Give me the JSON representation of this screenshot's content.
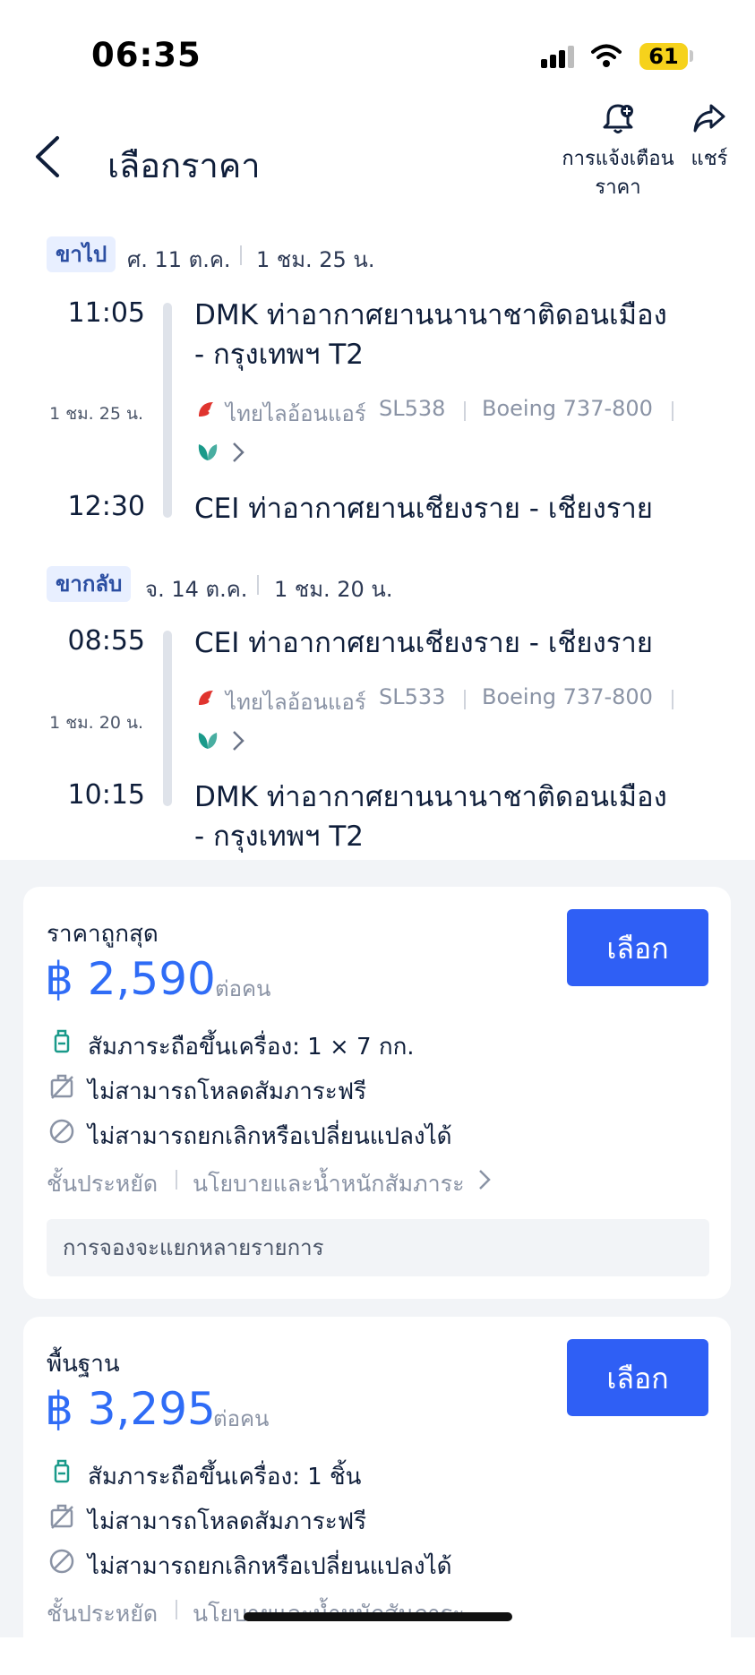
{
  "status_bar": {
    "time": "06:35",
    "battery": "61"
  },
  "header": {
    "title": "เลือกราคา",
    "alert_line1": "การแจ้งเตือน",
    "alert_line2": "ราคา",
    "share": "แชร์"
  },
  "outbound": {
    "chip": "ขาไป",
    "date": "ศ. 11 ต.ค.",
    "duration": "1 ชม. 25 น.",
    "dep_time": "11:05",
    "dep_airport_line1": "DMK  ท่าอากาศยานนานาชาติดอนเมือง",
    "dep_airport_line2": "- กรุงเทพฯ T2",
    "leg_duration": "1 ชม. 25 น.",
    "airline": "ไทยไลอ้อนแอร์",
    "flight_no": "SL538",
    "aircraft": "Boeing 737-800",
    "arr_time": "12:30",
    "arr_airport": "CEI  ท่าอากาศยานเชียงราย - เชียงราย"
  },
  "return": {
    "chip": "ขากลับ",
    "date": "จ. 14 ต.ค.",
    "duration": "1 ชม. 20 น.",
    "dep_time": "08:55",
    "dep_airport": "CEI  ท่าอากาศยานเชียงราย - เชียงราย",
    "leg_duration": "1 ชม. 20 น.",
    "airline": "ไทยไลอ้อนแอร์",
    "flight_no": "SL533",
    "aircraft": "Boeing 737-800",
    "arr_time": "10:15",
    "arr_airport_line1": "DMK  ท่าอากาศยานนานาชาติดอนเมือง",
    "arr_airport_line2": "- กรุงเทพฯ T2"
  },
  "fares": [
    {
      "title": "ราคาถูกสุด",
      "price": "฿ 2,590",
      "per": "ต่อคน",
      "button": "เลือก",
      "perk1": "สัมภาระถือขึ้นเครื่อง: 1 × 7 กก.",
      "perk2": "ไม่สามารถโหลดสัมภาระฟรี",
      "perk3": "ไม่สามารถยกเลิกหรือเปลี่ยนแปลงได้",
      "cabin": "ชั้นประหยัด",
      "policy": "นโยบายและน้ำหนักสัมภาระ",
      "notice": "การจองจะแยกหลายรายการ"
    },
    {
      "title": "พื้นฐาน",
      "price": "฿ 3,295",
      "per": "ต่อคน",
      "button": "เลือก",
      "perk1": "สัมภาระถือขึ้นเครื่อง: 1 ชิ้น",
      "perk2": "ไม่สามารถโหลดสัมภาระฟรี",
      "perk3": "ไม่สามารถยกเลิกหรือเปลี่ยนแปลงได้",
      "cabin": "ชั้นประหยัด",
      "policy": "นโยบายและน้ำหนักสัมภาระ"
    }
  ],
  "colors": {
    "accent": "#2f5ff5",
    "price": "#2f6cf6",
    "baggage_icon": "#1a9a8a"
  }
}
